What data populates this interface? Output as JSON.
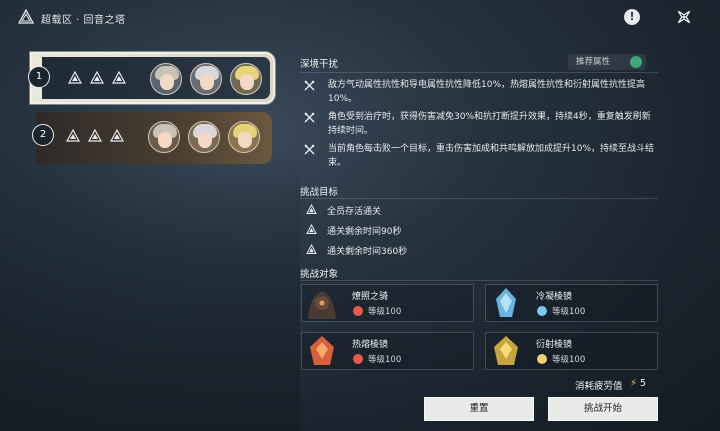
{
  "header": {
    "breadcrumb": "超载区 · 回音之塔",
    "alert_glyph": "!"
  },
  "floors": [
    {
      "number": "1",
      "selected": true
    },
    {
      "number": "2",
      "selected": false
    }
  ],
  "tower_effects": {
    "title": "深境干扰",
    "recommend_label": "推荐属性",
    "items": [
      "敌方气动属性抗性和导电属性抗性降低10%，热熔属性抗性和衍射属性抗性提高10%。",
      "角色受到治疗时，获得伤害减免30%和抗打断提升效果，持续4秒，重复触发刷新持续时间。",
      "当前角色每击败一个目标，重击伤害加成和共鸣解放加成提升10%，持续至战斗结束。"
    ]
  },
  "objectives": {
    "title": "挑战目标",
    "items": [
      "全员存活通关",
      "通关剩余时间90秒",
      "通关剩余时间360秒"
    ]
  },
  "enemies": {
    "title": "挑战对象",
    "items": [
      {
        "name": "燎照之骑",
        "level": "等级100",
        "element_color": "#e85a4a"
      },
      {
        "name": "冷凝棱镜",
        "level": "等级100",
        "element_color": "#7ac8f0"
      },
      {
        "name": "热熔棱镜",
        "level": "等级100",
        "element_color": "#e85a4a"
      },
      {
        "name": "衍射棱镜",
        "level": "等级100",
        "element_color": "#f0d070"
      }
    ]
  },
  "cost": {
    "label": "消耗疲劳值",
    "value": "5"
  },
  "buttons": {
    "reset": "重置",
    "start": "挑战开始"
  }
}
